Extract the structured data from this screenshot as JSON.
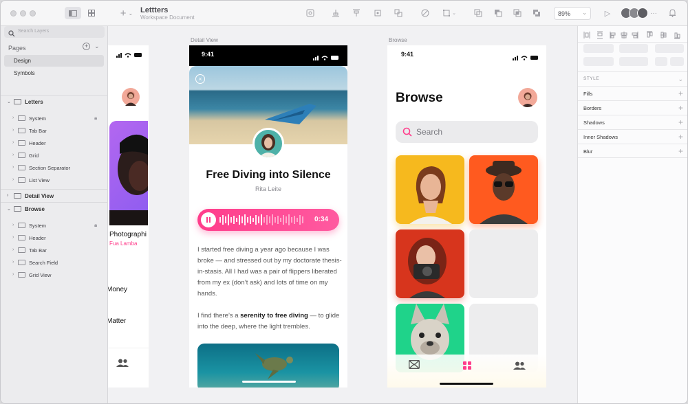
{
  "window": {
    "doc_title": "Lettters",
    "doc_subtitle": "Workspace Document",
    "zoom": "89%"
  },
  "sidebar": {
    "search_placeholder": "Search Layers",
    "pages_header": "Pages",
    "pages": [
      "Design",
      "Symbols"
    ],
    "artboards": [
      {
        "name": "Letters",
        "layers": [
          {
            "label": "System",
            "locked": true
          },
          {
            "label": "Tab Bar",
            "locked": false
          },
          {
            "label": "Header",
            "locked": false
          },
          {
            "label": "Grid",
            "locked": false
          },
          {
            "label": "Section Separator",
            "locked": false
          },
          {
            "label": "List View",
            "locked": false
          }
        ]
      },
      {
        "name": "Detail View",
        "layers": []
      },
      {
        "name": "Browse",
        "layers": [
          {
            "label": "System",
            "locked": true
          },
          {
            "label": "Header",
            "locked": false
          },
          {
            "label": "Tab Bar",
            "locked": false
          },
          {
            "label": "Search Field",
            "locked": false
          },
          {
            "label": "Grid View",
            "locked": false
          }
        ]
      }
    ]
  },
  "canvas": {
    "letters": {
      "card_title": "Photographi",
      "card_author": "Fua Lamba",
      "row1": "Money",
      "row2": "Matter"
    },
    "detail": {
      "label": "Detail View",
      "time": "9:41",
      "title": "Free Diving into Silence",
      "author": "Rita Leite",
      "audio_time": "0:34",
      "para1": "I started free diving a year ago because I was broke — and stressed out by my doctorate thesis-in-stasis. All I had was a pair of flippers liberated from my ex (don’t ask) and lots of time on my hands.",
      "para2_pre": "I find there’s a ",
      "para2_bold": "serenity to free diving",
      "para2_post": " — to glide into the deep, where the light trembles."
    },
    "browse": {
      "label": "Browse",
      "time": "9:41",
      "title": "Browse",
      "search_placeholder": "Search"
    }
  },
  "inspector": {
    "style_header": "STYLE",
    "sections": [
      "Fills",
      "Borders",
      "Shadows",
      "Inner Shadows",
      "Blur"
    ]
  },
  "colors": {
    "accent_pink": "#ff3d8b",
    "tile_yellow": "#f6b91e",
    "tile_orange": "#ff5a1f",
    "tile_red": "#d7351d",
    "tile_green": "#1fd38a"
  }
}
